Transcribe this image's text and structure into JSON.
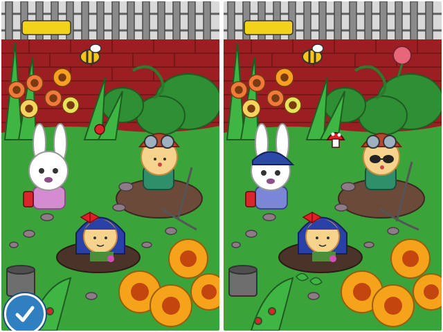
{
  "game": {
    "type": "spot-the-difference",
    "panels": [
      "original",
      "modified"
    ],
    "differences_in_modified": [
      "rose-flower-on-wall",
      "red-mushroom",
      "blue-cap-on-bunny",
      "sunglasses-on-boy",
      "shovel-position",
      "extra-leaves-near-hole",
      "missing-red-ball"
    ]
  },
  "ui": {
    "complete_button_icon": "checkmark-icon"
  },
  "colors": {
    "grass": "#3aa33a",
    "wall_brick": "#9b1f22",
    "fence": "#7a7a7a",
    "accent_blue": "#2f7fc1",
    "sunflower": "#f5a31a"
  }
}
